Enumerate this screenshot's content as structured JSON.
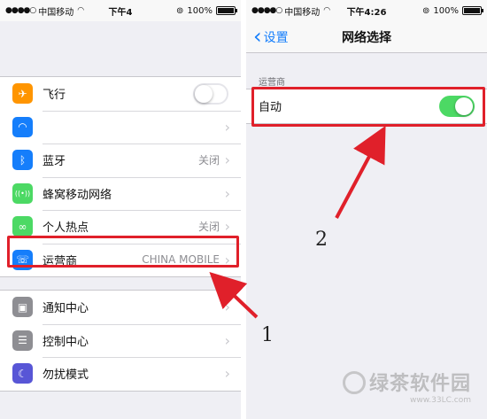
{
  "left_screen": {
    "status": {
      "carrier": "中国移动",
      "time": "下午4",
      "battery": "100%"
    },
    "rows_group1": [
      {
        "label": "飞行",
        "icon": "airplane-icon",
        "color": "#ff9500",
        "toggle": "off"
      },
      {
        "label": "",
        "icon": "wifi-icon",
        "color": "#157efb",
        "detail": ""
      },
      {
        "label": "蓝牙",
        "icon": "bluetooth-icon",
        "color": "#157efb",
        "detail": "关闭"
      },
      {
        "label": "蜂窝移动网络",
        "icon": "cellular-icon",
        "color": "#4cd964",
        "detail": ""
      },
      {
        "label": "个人热点",
        "icon": "hotspot-icon",
        "color": "#4cd964",
        "detail": "关闭"
      },
      {
        "label": "运营商",
        "icon": "carrier-phone-icon",
        "color": "#157efb",
        "detail": "CHINA MOBILE"
      }
    ],
    "rows_group2": [
      {
        "label": "通知中心",
        "icon": "notification-center-icon",
        "color": "#8e8e93"
      },
      {
        "label": "控制中心",
        "icon": "control-center-icon",
        "color": "#8e8e93"
      },
      {
        "label": "勿扰模式",
        "icon": "moon-icon",
        "color": "#5856d6"
      }
    ]
  },
  "right_screen": {
    "status": {
      "carrier": "中国移动",
      "time": "下午4:26",
      "battery": "100%"
    },
    "nav": {
      "back_label": "设置",
      "title": "网络选择"
    },
    "section_header": "运营商",
    "auto_row": {
      "label": "自动",
      "toggle": "on"
    }
  },
  "annotations": {
    "step1": "1",
    "step2": "2",
    "color": "#e0202a"
  },
  "watermark": {
    "title": "绿茶软件园",
    "url": "www.33LC.com"
  }
}
